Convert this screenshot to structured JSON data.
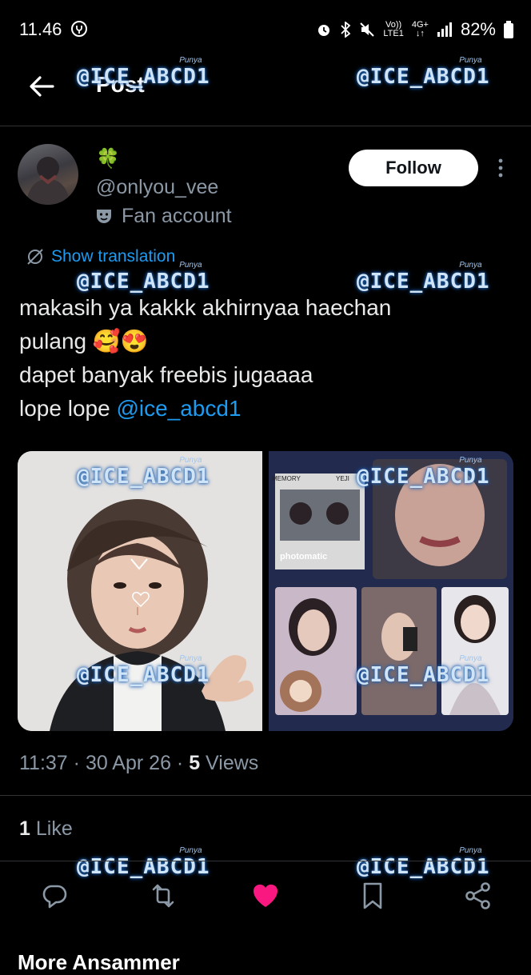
{
  "status_bar": {
    "time": "11.46",
    "network_top": "Vo))",
    "network_bottom": "LTE1",
    "gen_top": "4G+",
    "battery": "82%"
  },
  "header": {
    "title": "Post"
  },
  "author": {
    "display_name": "🍀",
    "handle": "@onlyou_vee",
    "label": "Fan account",
    "follow_label": "Follow"
  },
  "translation": {
    "label": "Show translation"
  },
  "tweet": {
    "line1": "makasih ya kakkk akhirnyaa haechan",
    "line2_text": "pulang ",
    "line2_emoji": "🥰😍",
    "line3": "dapet banyak freebis jugaaaa",
    "line4_text": "lope lope ",
    "mention": "@ice_abcd1"
  },
  "media": {
    "right_card_text_1": "photomatic",
    "right_card_text_2": "MEMORY",
    "right_card_text_3": "YEJI"
  },
  "meta": {
    "time": "11:37",
    "date": "30 Apr 26",
    "views_count": "5",
    "views_label": "Views"
  },
  "engagement": {
    "likes_count": "1",
    "likes_label": "Like"
  },
  "footer": {
    "more_replies": "More Ansammer"
  },
  "watermark": {
    "text": "@ICE_ABCD1",
    "sub": "Punya"
  },
  "colors": {
    "accent": "#1d9bf0",
    "like": "#f91880",
    "muted": "#8b98a5"
  },
  "icons": [
    "back-arrow-icon",
    "more-vertical-icon",
    "translate-icon",
    "mask-icon",
    "reply-icon",
    "retweet-icon",
    "heart-icon",
    "bookmark-icon",
    "share-icon",
    "alarm-icon",
    "bluetooth-icon",
    "mute-icon",
    "signal-icon",
    "battery-icon"
  ]
}
